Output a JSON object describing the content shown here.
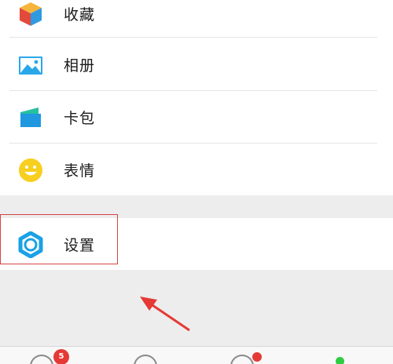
{
  "menu": {
    "items": [
      {
        "label": "收藏",
        "icon": "favorites-cube-icon"
      },
      {
        "label": "相册",
        "icon": "album-picture-icon"
      },
      {
        "label": "卡包",
        "icon": "card-wallet-icon"
      },
      {
        "label": "表情",
        "icon": "smiley-face-icon"
      }
    ]
  },
  "settings": {
    "label": "设置",
    "icon": "gear-icon"
  },
  "tabbar": {
    "badge_count": "5"
  },
  "colors": {
    "highlight_border": "#d64545",
    "arrow": "#e53935",
    "icon_blue": "#1aa1e6",
    "badge": "#e53935",
    "online_dot": "#2ecc40"
  }
}
